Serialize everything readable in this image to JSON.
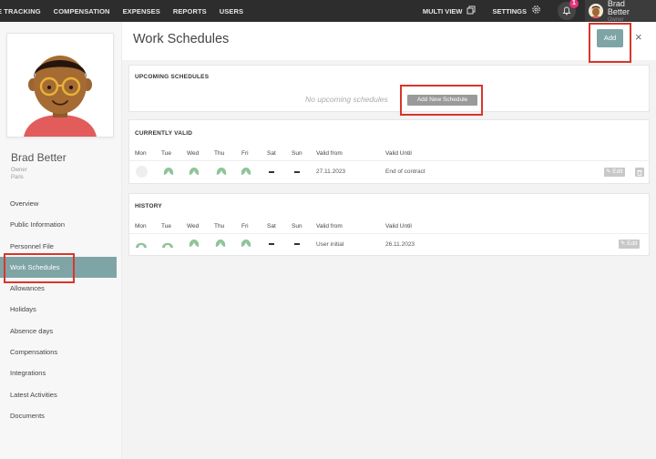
{
  "topbar": {
    "nav": [
      "E TRACKING",
      "COMPENSATION",
      "EXPENSES",
      "REPORTS",
      "USERS"
    ],
    "multi_view_label": "MULTI VIEW",
    "settings_label": "SETTINGS",
    "notification_count": "1",
    "user_name": "Brad Better",
    "user_role": "Owner"
  },
  "profile": {
    "name": "Brad Better",
    "role": "Owner",
    "city": "Paris"
  },
  "sidebar": {
    "items": [
      {
        "label": "Overview"
      },
      {
        "label": "Public Information"
      },
      {
        "label": "Personnel File"
      },
      {
        "label": "Work Schedules"
      },
      {
        "label": "Allowances"
      },
      {
        "label": "Holidays"
      },
      {
        "label": "Absence days"
      },
      {
        "label": "Compensations"
      },
      {
        "label": "Integrations"
      },
      {
        "label": "Latest Activities"
      },
      {
        "label": "Documents"
      }
    ],
    "active_index": 3
  },
  "page": {
    "title": "Work Schedules",
    "add_label": "Add",
    "close_symbol": "×"
  },
  "upcoming": {
    "title": "UPCOMING SCHEDULES",
    "empty_text": "No upcoming schedules",
    "add_new_label": "Add New Schedule"
  },
  "current": {
    "title": "CURRENTLY VALID",
    "columns": [
      "Mon",
      "Tue",
      "Wed",
      "Thu",
      "Fri",
      "Sat",
      "Sun",
      "Valid from",
      "Valid Until"
    ],
    "row": {
      "valid_from": "27.11.2023",
      "valid_until": "End of contract",
      "edit_label": "Edit"
    }
  },
  "history": {
    "title": "HISTORY",
    "columns": [
      "Mon",
      "Tue",
      "Wed",
      "Thu",
      "Fri",
      "Sat",
      "Sun",
      "Valid from",
      "Valid Until"
    ],
    "row": {
      "valid_from": "User initial",
      "valid_until": "26.11.2023",
      "edit_label": "Edit"
    }
  },
  "colors": {
    "accent": "#7fa4a6",
    "leaf": "#8ec49a",
    "highlight": "#d9362a",
    "topbar": "#2d2d2d"
  }
}
